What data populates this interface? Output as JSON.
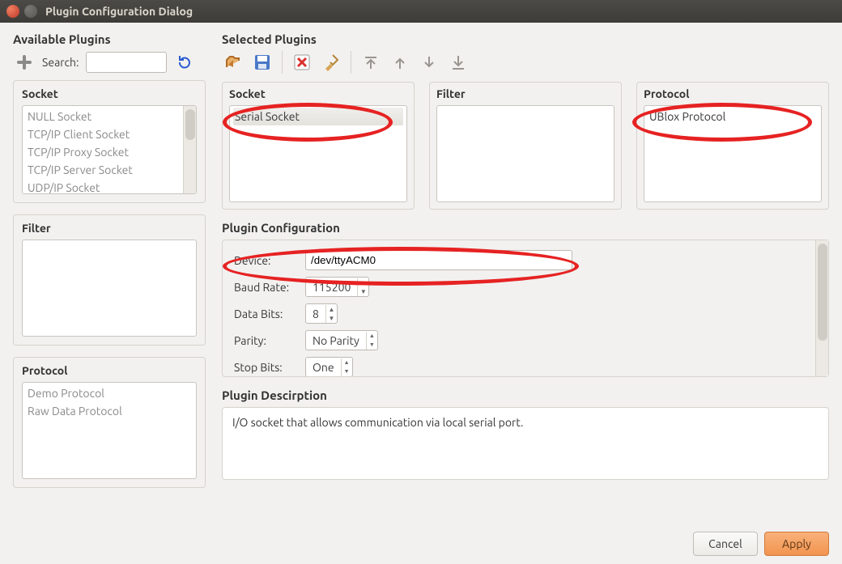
{
  "titlebar": {
    "title": "Plugin Configuration Dialog"
  },
  "left": {
    "available_heading": "Available Plugins",
    "search_label": "Search:",
    "socket": {
      "title": "Socket",
      "items": [
        "NULL Socket",
        "TCP/IP Client Socket",
        "TCP/IP Proxy Socket",
        "TCP/IP Server Socket",
        "UDP/IP Socket"
      ]
    },
    "filter": {
      "title": "Filter",
      "items": []
    },
    "protocol": {
      "title": "Protocol",
      "items": [
        "Demo Protocol",
        "Raw Data Protocol"
      ]
    }
  },
  "right": {
    "selected_heading": "Selected Plugins",
    "socket": {
      "title": "Socket",
      "items": [
        "Serial Socket"
      ],
      "selected_index": 0
    },
    "filter": {
      "title": "Filter",
      "items": []
    },
    "protocol": {
      "title": "Protocol",
      "items": [
        "UBlox Protocol"
      ]
    }
  },
  "config": {
    "heading": "Plugin Configuration",
    "device_label": "Device:",
    "device_value": "/dev/ttyACM0",
    "baud_label": "Baud Rate:",
    "baud_value": "115200",
    "databits_label": "Data Bits:",
    "databits_value": "8",
    "parity_label": "Parity:",
    "parity_value": "No Parity",
    "stopbits_label": "Stop Bits:",
    "stopbits_value": "One"
  },
  "description": {
    "heading": "Plugin Descirption",
    "text": "I/O socket that allows communication via local serial port."
  },
  "buttons": {
    "cancel": "Cancel",
    "apply": "Apply"
  }
}
